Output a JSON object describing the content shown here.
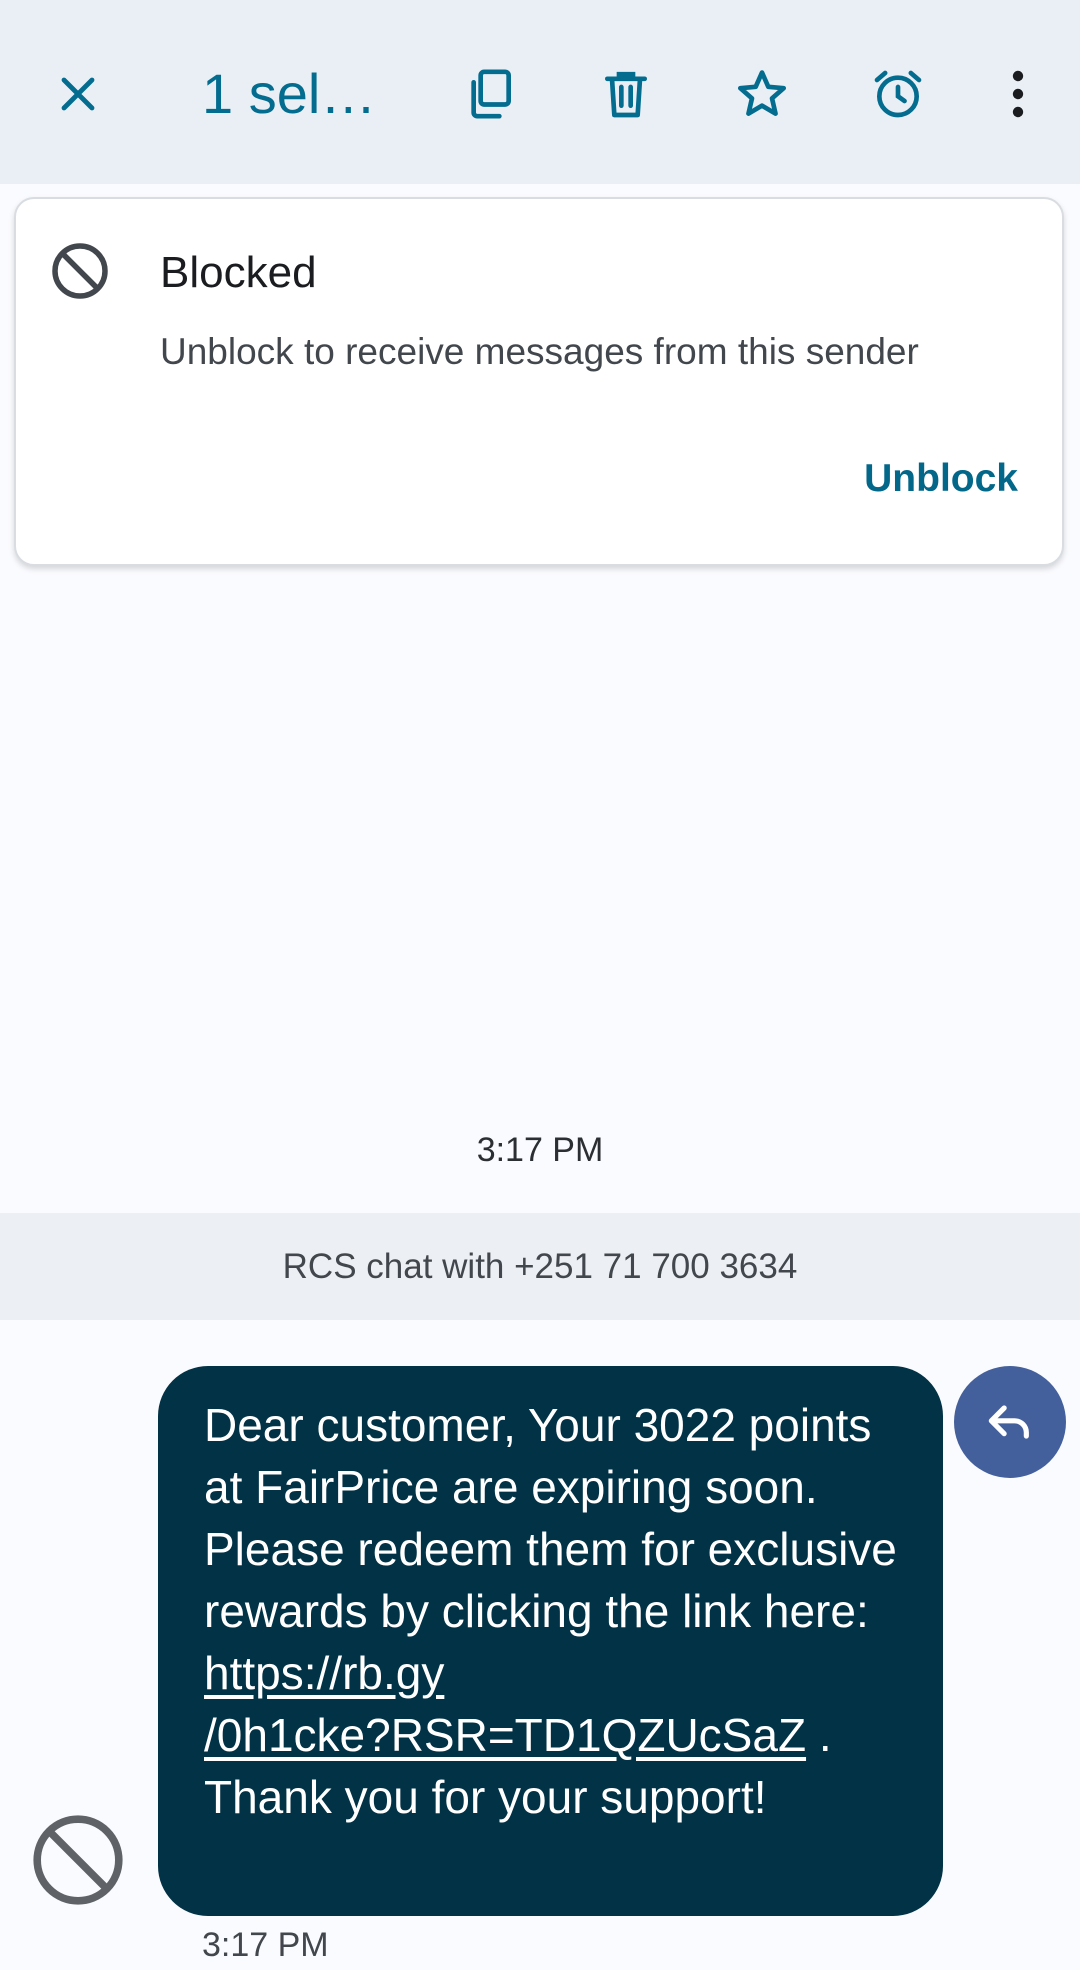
{
  "appbar": {
    "title": "1 sele…",
    "icons": {
      "close": "close-icon",
      "copy": "copy-icon",
      "delete": "delete-icon",
      "star": "star-icon",
      "reminder": "alarm-icon",
      "more": "more-vert-icon"
    }
  },
  "blocked_card": {
    "title": "Blocked",
    "body": "Unblock to receive messages from this sender",
    "action": "Unblock"
  },
  "conversation": {
    "time_divider": "3:17 PM",
    "rcs_banner": "RCS chat with +251 71 700 3634",
    "message": {
      "text_before_link": "Dear customer, Your 3022 points at FairPrice are expiring soon. Please redeem them for exclusive rewards by clicking the link here:",
      "link_line1": "https://rb.gy",
      "link_line2": "/0h1cke?RSR=TD1QZUcSaZ",
      "text_after_link": ". Thank you for your support!",
      "time": "3:17 PM"
    }
  },
  "colors": {
    "appbar_bg": "#e9eff5",
    "accent": "#036c8f",
    "bubble_bg": "#023246",
    "reply_bg": "#44609c",
    "banner_bg": "#eceff3"
  }
}
